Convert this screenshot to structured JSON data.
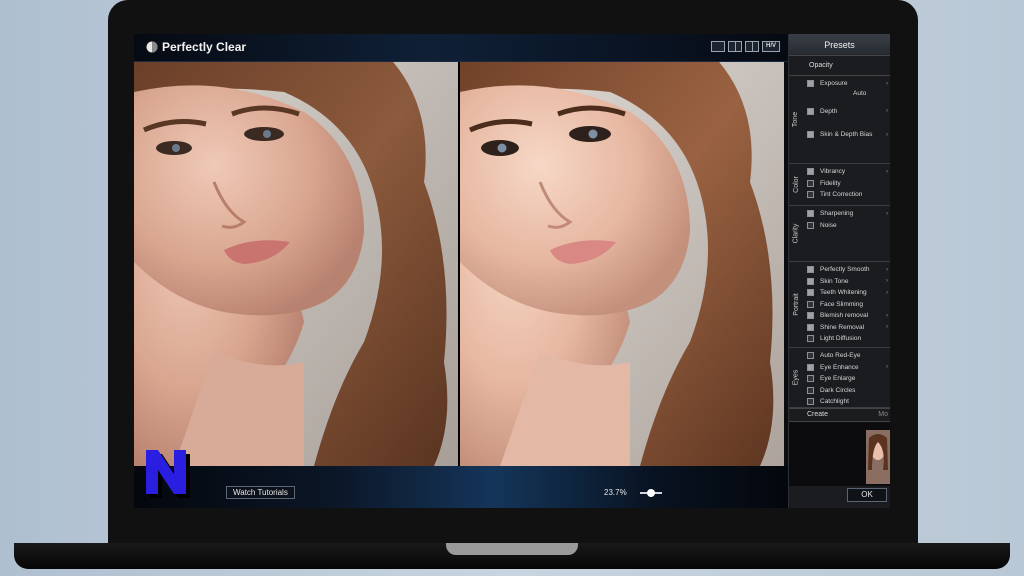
{
  "app": {
    "title": "Perfectly Clear",
    "view_buttons": [
      "single",
      "split-2",
      "split-3",
      "H/V"
    ]
  },
  "bottom_bar": {
    "watch_tutorials": "Watch Tutorials",
    "zoom": "23.7%",
    "zoom_level_fraction": 0.35
  },
  "panel": {
    "presets": "Presets",
    "opacity": "Opacity",
    "sections": [
      {
        "label": "Tone",
        "items": [
          {
            "label": "Exposure",
            "checked": true,
            "note": "Auto"
          },
          {
            "label": "Depth",
            "checked": true
          },
          {
            "label": "Skin & Depth Bias",
            "checked": true
          }
        ]
      },
      {
        "label": "Color",
        "items": [
          {
            "label": "Vibrancy",
            "checked": true
          },
          {
            "label": "Fidelity",
            "checked": false
          },
          {
            "label": "Tint Correction",
            "checked": false
          }
        ]
      },
      {
        "label": "Clarity",
        "items": [
          {
            "label": "Sharpening",
            "checked": true
          },
          {
            "label": "Noise",
            "checked": false
          }
        ]
      },
      {
        "label": "Portrait",
        "items": [
          {
            "label": "Perfectly Smooth",
            "checked": true
          },
          {
            "label": "Skin Tone",
            "checked": true
          },
          {
            "label": "Teeth Whitening",
            "checked": true
          },
          {
            "label": "Face Slimming",
            "checked": false
          },
          {
            "label": "Blemish removal",
            "checked": true
          },
          {
            "label": "Shine Removal",
            "checked": true
          },
          {
            "label": "Light Diffusion",
            "checked": false
          }
        ]
      },
      {
        "label": "Eyes",
        "items": [
          {
            "label": "Auto Red-Eye",
            "checked": false
          },
          {
            "label": "Eye Enhance",
            "checked": true
          },
          {
            "label": "Eye Enlarge",
            "checked": false
          },
          {
            "label": "Dark Circles",
            "checked": false
          },
          {
            "label": "Catchlight",
            "checked": false
          }
        ]
      }
    ],
    "tabs": [
      "Create",
      "Mo"
    ],
    "ok": "OK"
  },
  "overlay_logo": {
    "letter": "N",
    "color": "#2a1fe0"
  },
  "colors": {
    "accent": "#15355a",
    "logo": "#2a1fe0"
  }
}
